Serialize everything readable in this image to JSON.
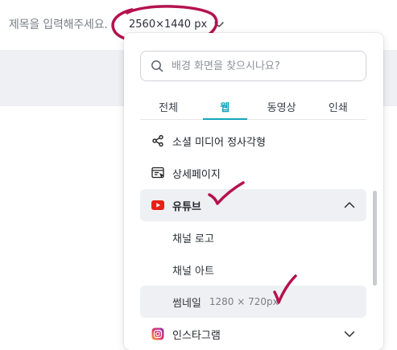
{
  "header": {
    "doc_title_placeholder": "제목을 입력해주세요.",
    "size_label": "2560×1440 px"
  },
  "dropdown": {
    "search_placeholder": "배경 화면을 찾으시나요?",
    "tabs": [
      {
        "label": "전체",
        "active": false
      },
      {
        "label": "웹",
        "active": true
      },
      {
        "label": "동영상",
        "active": false
      },
      {
        "label": "인쇄",
        "active": false
      }
    ],
    "items": {
      "social": {
        "label": "소셜 미디어 정사각형",
        "icon": "share-icon"
      },
      "detail": {
        "label": "상세페이지",
        "icon": "webpage-icon"
      },
      "youtube": {
        "label": "유튜브",
        "icon": "youtube-icon",
        "expanded": true,
        "children": {
          "channel_logo": "채널 로고",
          "channel_art": "채널 아트",
          "thumbnail": "썸네일",
          "thumbnail_size": "1280 × 720px"
        }
      },
      "instagram": {
        "label": "인스타그램",
        "icon": "instagram-icon",
        "expanded": false
      }
    }
  },
  "colors": {
    "accent": "#13a6bd",
    "annotation": "#b5124f",
    "youtube": "#e62117",
    "canvas": "#eef0f4"
  }
}
